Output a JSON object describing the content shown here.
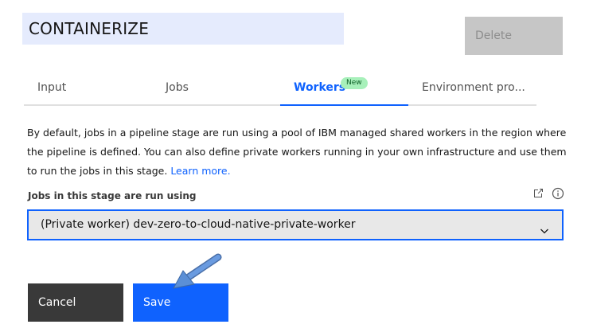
{
  "header": {
    "name_value": "CONTAINERIZE",
    "delete_label": "Delete"
  },
  "tabs": [
    {
      "label": "Input",
      "active": false
    },
    {
      "label": "Jobs",
      "active": false
    },
    {
      "label": "Workers",
      "active": true,
      "badge": "New"
    },
    {
      "label": "Environment pro...",
      "active": false
    }
  ],
  "workers": {
    "description": "By default, jobs in a pipeline stage are run using a pool of IBM managed shared workers in the region where the pipeline is defined. You can also define private workers running in your own infrastructure and use them to run the jobs in this stage. ",
    "learn_more": "Learn more.",
    "field_label": "Jobs in this stage are run using",
    "field_icons": [
      "launch-icon",
      "information-icon"
    ],
    "selected_worker": "(Private worker) dev-zero-to-cloud-native-private-worker"
  },
  "actions": {
    "cancel_label": "Cancel",
    "save_label": "Save"
  },
  "colors": {
    "primary": "#0f62fe",
    "badge_bg": "#a7f0ba",
    "badge_text": "#0e6027",
    "arrow": "#5b8fd6"
  }
}
